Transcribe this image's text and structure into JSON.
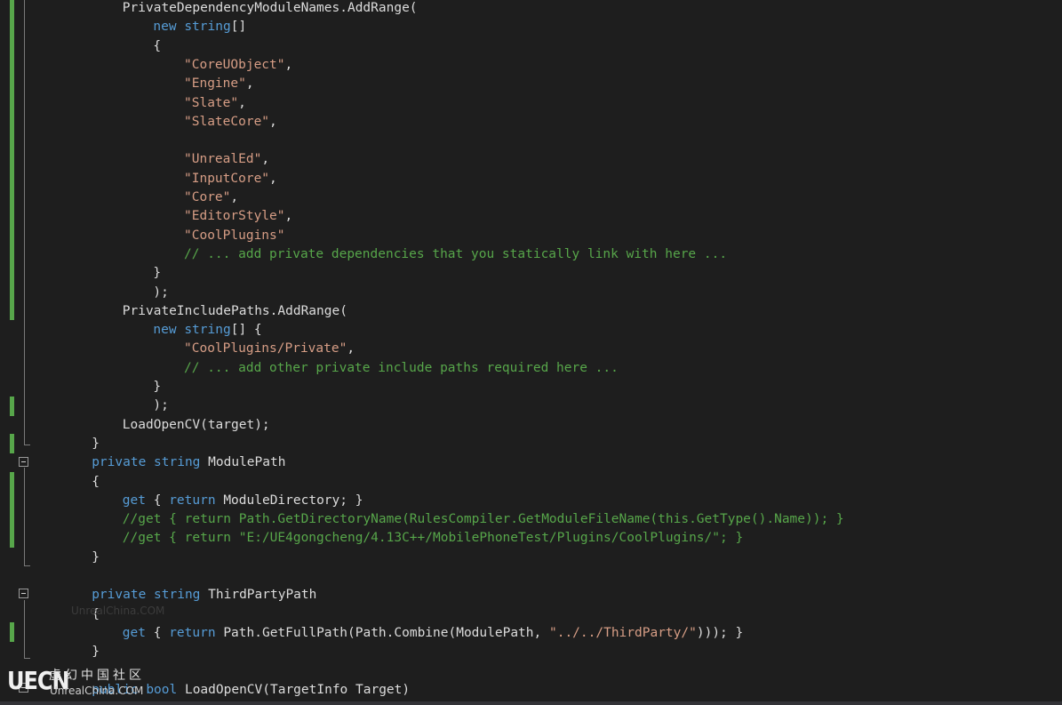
{
  "editor": {
    "lines": [
      {
        "indent": 3,
        "tokens": [
          [
            "pl",
            "PrivateDependencyModuleNames.AddRange("
          ]
        ]
      },
      {
        "indent": 4,
        "tokens": [
          [
            "kw",
            "new"
          ],
          [
            "pl",
            " "
          ],
          [
            "kw",
            "string"
          ],
          [
            "pl",
            "[]"
          ]
        ]
      },
      {
        "indent": 4,
        "tokens": [
          [
            "pl",
            "{"
          ]
        ]
      },
      {
        "indent": 5,
        "tokens": [
          [
            "str",
            "\"CoreUObject\""
          ],
          [
            "pl",
            ","
          ]
        ]
      },
      {
        "indent": 5,
        "tokens": [
          [
            "str",
            "\"Engine\""
          ],
          [
            "pl",
            ","
          ]
        ]
      },
      {
        "indent": 5,
        "tokens": [
          [
            "str",
            "\"Slate\""
          ],
          [
            "pl",
            ","
          ]
        ]
      },
      {
        "indent": 5,
        "tokens": [
          [
            "str",
            "\"SlateCore\""
          ],
          [
            "pl",
            ","
          ]
        ]
      },
      {
        "indent": 0,
        "tokens": []
      },
      {
        "indent": 5,
        "tokens": [
          [
            "str",
            "\"UnrealEd\""
          ],
          [
            "pl",
            ","
          ]
        ]
      },
      {
        "indent": 5,
        "tokens": [
          [
            "str",
            "\"InputCore\""
          ],
          [
            "pl",
            ","
          ]
        ]
      },
      {
        "indent": 5,
        "tokens": [
          [
            "str",
            "\"Core\""
          ],
          [
            "pl",
            ","
          ]
        ]
      },
      {
        "indent": 5,
        "tokens": [
          [
            "str",
            "\"EditorStyle\""
          ],
          [
            "pl",
            ","
          ]
        ]
      },
      {
        "indent": 5,
        "tokens": [
          [
            "str",
            "\"CoolPlugins\""
          ]
        ]
      },
      {
        "indent": 5,
        "tokens": [
          [
            "cm",
            "// ... add private dependencies that you statically link with here ..."
          ]
        ]
      },
      {
        "indent": 4,
        "tokens": [
          [
            "pl",
            "}"
          ]
        ]
      },
      {
        "indent": 4,
        "tokens": [
          [
            "pl",
            ");"
          ]
        ]
      },
      {
        "indent": 3,
        "tokens": [
          [
            "pl",
            "PrivateIncludePaths.AddRange("
          ]
        ]
      },
      {
        "indent": 4,
        "tokens": [
          [
            "kw",
            "new"
          ],
          [
            "pl",
            " "
          ],
          [
            "kw",
            "string"
          ],
          [
            "pl",
            "[] {"
          ]
        ]
      },
      {
        "indent": 5,
        "tokens": [
          [
            "str",
            "\"CoolPlugins/Private\""
          ],
          [
            "pl",
            ","
          ]
        ]
      },
      {
        "indent": 5,
        "tokens": [
          [
            "cm",
            "// ... add other private include paths required here ..."
          ]
        ]
      },
      {
        "indent": 4,
        "tokens": [
          [
            "pl",
            "}"
          ]
        ]
      },
      {
        "indent": 4,
        "tokens": [
          [
            "pl",
            ");"
          ]
        ]
      },
      {
        "indent": 3,
        "tokens": [
          [
            "pl",
            "LoadOpenCV(target);"
          ]
        ]
      },
      {
        "indent": 2,
        "tokens": [
          [
            "pl",
            "}"
          ]
        ]
      },
      {
        "indent": 2,
        "tokens": [
          [
            "kw",
            "private"
          ],
          [
            "pl",
            " "
          ],
          [
            "kw",
            "string"
          ],
          [
            "pl",
            " ModulePath"
          ]
        ]
      },
      {
        "indent": 2,
        "tokens": [
          [
            "pl",
            "{"
          ]
        ]
      },
      {
        "indent": 3,
        "tokens": [
          [
            "kw",
            "get"
          ],
          [
            "pl",
            " { "
          ],
          [
            "kw",
            "return"
          ],
          [
            "pl",
            " ModuleDirectory; }"
          ]
        ]
      },
      {
        "indent": 3,
        "tokens": [
          [
            "cm",
            "//get { return Path.GetDirectoryName(RulesCompiler.GetModuleFileName(this.GetType().Name)); }"
          ]
        ]
      },
      {
        "indent": 3,
        "tokens": [
          [
            "cm",
            "//get { return \"E:/UE4gongcheng/4.13C++/MobilePhoneTest/Plugins/CoolPlugins/\"; }"
          ]
        ]
      },
      {
        "indent": 2,
        "tokens": [
          [
            "pl",
            "}"
          ]
        ]
      },
      {
        "indent": 0,
        "tokens": []
      },
      {
        "indent": 2,
        "tokens": [
          [
            "kw",
            "private"
          ],
          [
            "pl",
            " "
          ],
          [
            "kw",
            "string"
          ],
          [
            "pl",
            " ThirdPartyPath"
          ]
        ]
      },
      {
        "indent": 2,
        "tokens": [
          [
            "pl",
            "{"
          ]
        ]
      },
      {
        "indent": 3,
        "tokens": [
          [
            "kw",
            "get"
          ],
          [
            "pl",
            " { "
          ],
          [
            "kw",
            "return"
          ],
          [
            "pl",
            " Path.GetFullPath(Path.Combine(ModulePath, "
          ],
          [
            "str",
            "\"../../ThirdParty/\""
          ],
          [
            "pl",
            "))); }"
          ]
        ]
      },
      {
        "indent": 2,
        "tokens": [
          [
            "pl",
            "}"
          ]
        ]
      },
      {
        "indent": 0,
        "tokens": []
      },
      {
        "indent": 2,
        "tokens": [
          [
            "kw",
            "public"
          ],
          [
            "pl",
            " "
          ],
          [
            "kw",
            "bool"
          ],
          [
            "pl",
            " LoadOpenCV(TargetInfo Target)"
          ]
        ]
      }
    ]
  },
  "watermark": {
    "logo": "UECN",
    "chinese": "虚幻中国社区",
    "english": "UnrealChina.COM",
    "faint": "UnrealChina.COM"
  }
}
